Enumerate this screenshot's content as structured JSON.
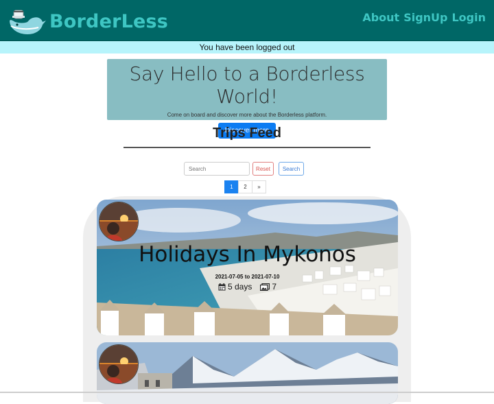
{
  "nav": {
    "brand": "BorderLess",
    "links": [
      "About",
      "SignUp",
      "Login"
    ]
  },
  "flash": {
    "message": "You have been logged out"
  },
  "jumbotron": {
    "title": "Say Hello to a Borderless World!",
    "subtitle": "Come on board and discover more about the Borderless platform.",
    "button": "Discover more"
  },
  "feed": {
    "title": "Trips Feed",
    "search_placeholder": "Search",
    "reset_label": "Reset",
    "search_label": "Search",
    "pages": [
      "1",
      "2",
      "»"
    ],
    "active_page": "1"
  },
  "trips": [
    {
      "title": "Holidays In Mykonos",
      "dates": "2021-07-05 to 2021-07-10",
      "days": "5 days",
      "photos": "7"
    },
    {
      "title": ""
    }
  ],
  "colors": {
    "navbar": "#006766",
    "brand": "#3ec6c3",
    "flash": "#b7f4fb",
    "jumbotron": "#88bdc2",
    "primary_button": "#0c7cf2"
  }
}
